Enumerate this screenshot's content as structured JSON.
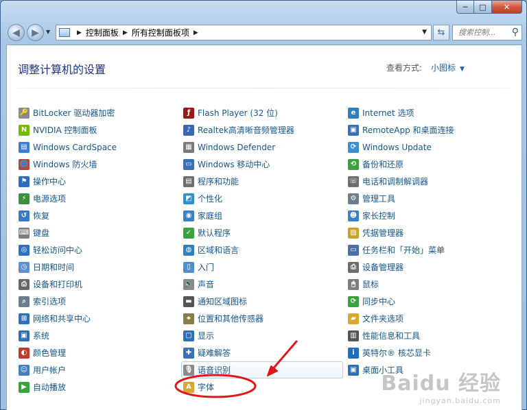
{
  "window": {
    "buttons": {
      "minimize": "─",
      "maximize": "□",
      "close": "✕"
    }
  },
  "nav": {
    "breadcrumbs": [
      "控制面板",
      "所有控制面板项"
    ],
    "search_placeholder": "搜索控制..."
  },
  "header": {
    "title": "调整计算机的设置",
    "view_by_label": "查看方式:",
    "view_by_value": "小图标"
  },
  "columns": [
    [
      {
        "label": "BitLocker 驱动器加密",
        "icon": "bitlocker-icon",
        "color": "#8a8a8a",
        "glyph": "🔑"
      },
      {
        "label": "NVIDIA 控制面板",
        "icon": "nvidia-icon",
        "color": "#76b900",
        "glyph": "N"
      },
      {
        "label": "Windows CardSpace",
        "icon": "cardspace-icon",
        "color": "#3b7bd1",
        "glyph": "▤"
      },
      {
        "label": "Windows 防火墙",
        "icon": "firewall-icon",
        "color": "#b5473a",
        "glyph": "🌐"
      },
      {
        "label": "操作中心",
        "icon": "action-center-flag-icon",
        "color": "#2d6bc2",
        "glyph": "⚑"
      },
      {
        "label": "电源选项",
        "icon": "power-options-icon",
        "color": "#3c8f3c",
        "glyph": "⚡"
      },
      {
        "label": "恢复",
        "icon": "recovery-icon",
        "color": "#3a78c6",
        "glyph": "↺"
      },
      {
        "label": "键盘",
        "icon": "keyboard-icon",
        "color": "#7d7d7d",
        "glyph": "⌨"
      },
      {
        "label": "轻松访问中心",
        "icon": "ease-of-access-icon",
        "color": "#2e6fbf",
        "glyph": "◎"
      },
      {
        "label": "日期和时间",
        "icon": "date-time-icon",
        "color": "#5b8fd0",
        "glyph": "◷"
      },
      {
        "label": "设备和打印机",
        "icon": "printer-icon",
        "color": "#666666",
        "glyph": "⎙"
      },
      {
        "label": "索引选项",
        "icon": "indexing-icon",
        "color": "#6d7c8f",
        "glyph": "⌕"
      },
      {
        "label": "网络和共享中心",
        "icon": "network-icon",
        "color": "#2f6fb8",
        "glyph": "⊞"
      },
      {
        "label": "系统",
        "icon": "system-icon",
        "color": "#2f6fb8",
        "glyph": "▣"
      },
      {
        "label": "颜色管理",
        "icon": "color-management-icon",
        "color": "#c0392b",
        "glyph": "◐"
      },
      {
        "label": "用户帐户",
        "icon": "user-accounts-icon",
        "color": "#3f7fbf",
        "glyph": "☺"
      },
      {
        "label": "自动播放",
        "icon": "autoplay-icon",
        "color": "#3aa340",
        "glyph": "▶"
      }
    ],
    [
      {
        "label": "Flash Player (32 位)",
        "icon": "flash-player-icon",
        "color": "#9b1a1a",
        "glyph": "ƒ"
      },
      {
        "label": "Realtek高清晰音频管理器",
        "icon": "realtek-audio-icon",
        "color": "#3a66b5",
        "glyph": "♪"
      },
      {
        "label": "Windows Defender",
        "icon": "defender-icon",
        "color": "#7a7a7a",
        "glyph": "▦"
      },
      {
        "label": "Windows 移动中心",
        "icon": "mobility-center-icon",
        "color": "#3b6fb6",
        "glyph": "▭"
      },
      {
        "label": "程序和功能",
        "icon": "programs-features-icon",
        "color": "#6d6d6d",
        "glyph": "▤"
      },
      {
        "label": "个性化",
        "icon": "personalization-icon",
        "color": "#2f8fd0",
        "glyph": "◩"
      },
      {
        "label": "家庭组",
        "icon": "homegroup-icon",
        "color": "#3a7fc8",
        "glyph": "◉"
      },
      {
        "label": "默认程序",
        "icon": "default-programs-icon",
        "color": "#3aa340",
        "glyph": "✓"
      },
      {
        "label": "区域和语言",
        "icon": "region-language-icon",
        "color": "#2f7fc0",
        "glyph": "◍"
      },
      {
        "label": "入门",
        "icon": "getting-started-icon",
        "color": "#4f8fd0",
        "glyph": "▯"
      },
      {
        "label": "声音",
        "icon": "sound-icon",
        "color": "#8a8a8a",
        "glyph": "🔈"
      },
      {
        "label": "通知区域图标",
        "icon": "notification-area-icon",
        "color": "#555555",
        "glyph": "▬"
      },
      {
        "label": "位置和其他传感器",
        "icon": "location-sensors-icon",
        "color": "#8a7d4a",
        "glyph": "⌖"
      },
      {
        "label": "显示",
        "icon": "display-icon",
        "color": "#2f6fb8",
        "glyph": "▢"
      },
      {
        "label": "疑难解答",
        "icon": "troubleshooting-icon",
        "color": "#3a6fb5",
        "glyph": "✚"
      },
      {
        "label": "语音识别",
        "icon": "microphone-icon",
        "color": "#8a8a8a",
        "glyph": "🎙"
      },
      {
        "label": "字体",
        "icon": "fonts-folder-icon",
        "color": "#d9a62e",
        "glyph": "A"
      }
    ],
    [
      {
        "label": "Internet 选项",
        "icon": "internet-options-icon",
        "color": "#2f7fc0",
        "glyph": "e"
      },
      {
        "label": "RemoteApp 和桌面连接",
        "icon": "remoteapp-icon",
        "color": "#3a6fb5",
        "glyph": "▣"
      },
      {
        "label": "Windows Update",
        "icon": "windows-update-icon",
        "color": "#3a8fd0",
        "glyph": "⟳"
      },
      {
        "label": "备份和还原",
        "icon": "backup-restore-icon",
        "color": "#3aa340",
        "glyph": "⟲"
      },
      {
        "label": "电话和调制解调器",
        "icon": "phone-modem-icon",
        "color": "#6d6d6d",
        "glyph": "☏"
      },
      {
        "label": "管理工具",
        "icon": "admin-tools-icon",
        "color": "#6d7c8f",
        "glyph": "⚙"
      },
      {
        "label": "家长控制",
        "icon": "parental-controls-icon",
        "color": "#3a7fc8",
        "glyph": "☻"
      },
      {
        "label": "凭据管理器",
        "icon": "credential-manager-icon",
        "color": "#c9a227",
        "glyph": "▧"
      },
      {
        "label": "任务栏和「开始」菜单",
        "icon": "taskbar-start-menu-icon",
        "color": "#4a6fa5",
        "glyph": "▭"
      },
      {
        "label": "设备管理器",
        "icon": "device-manager-icon",
        "color": "#6d6d6d",
        "glyph": "⎙"
      },
      {
        "label": "鼠标",
        "icon": "mouse-icon",
        "color": "#7d7d7d",
        "glyph": "🖱"
      },
      {
        "label": "同步中心",
        "icon": "sync-center-icon",
        "color": "#3aa340",
        "glyph": "⟳"
      },
      {
        "label": "文件夹选项",
        "icon": "folder-options-icon",
        "color": "#d9a62e",
        "glyph": "▰"
      },
      {
        "label": "性能信息和工具",
        "icon": "performance-icon",
        "color": "#555555",
        "glyph": "▥"
      },
      {
        "label": "英特尔® 核芯显卡",
        "icon": "intel-graphics-icon",
        "color": "#1c6fc0",
        "glyph": "i"
      },
      {
        "label": "桌面小工具",
        "icon": "desktop-gadgets-icon",
        "color": "#2f6fb8",
        "glyph": "▣"
      }
    ]
  ],
  "watermark": {
    "line1": "Baidu 经验",
    "line2": "jingyan.baidu.com"
  }
}
